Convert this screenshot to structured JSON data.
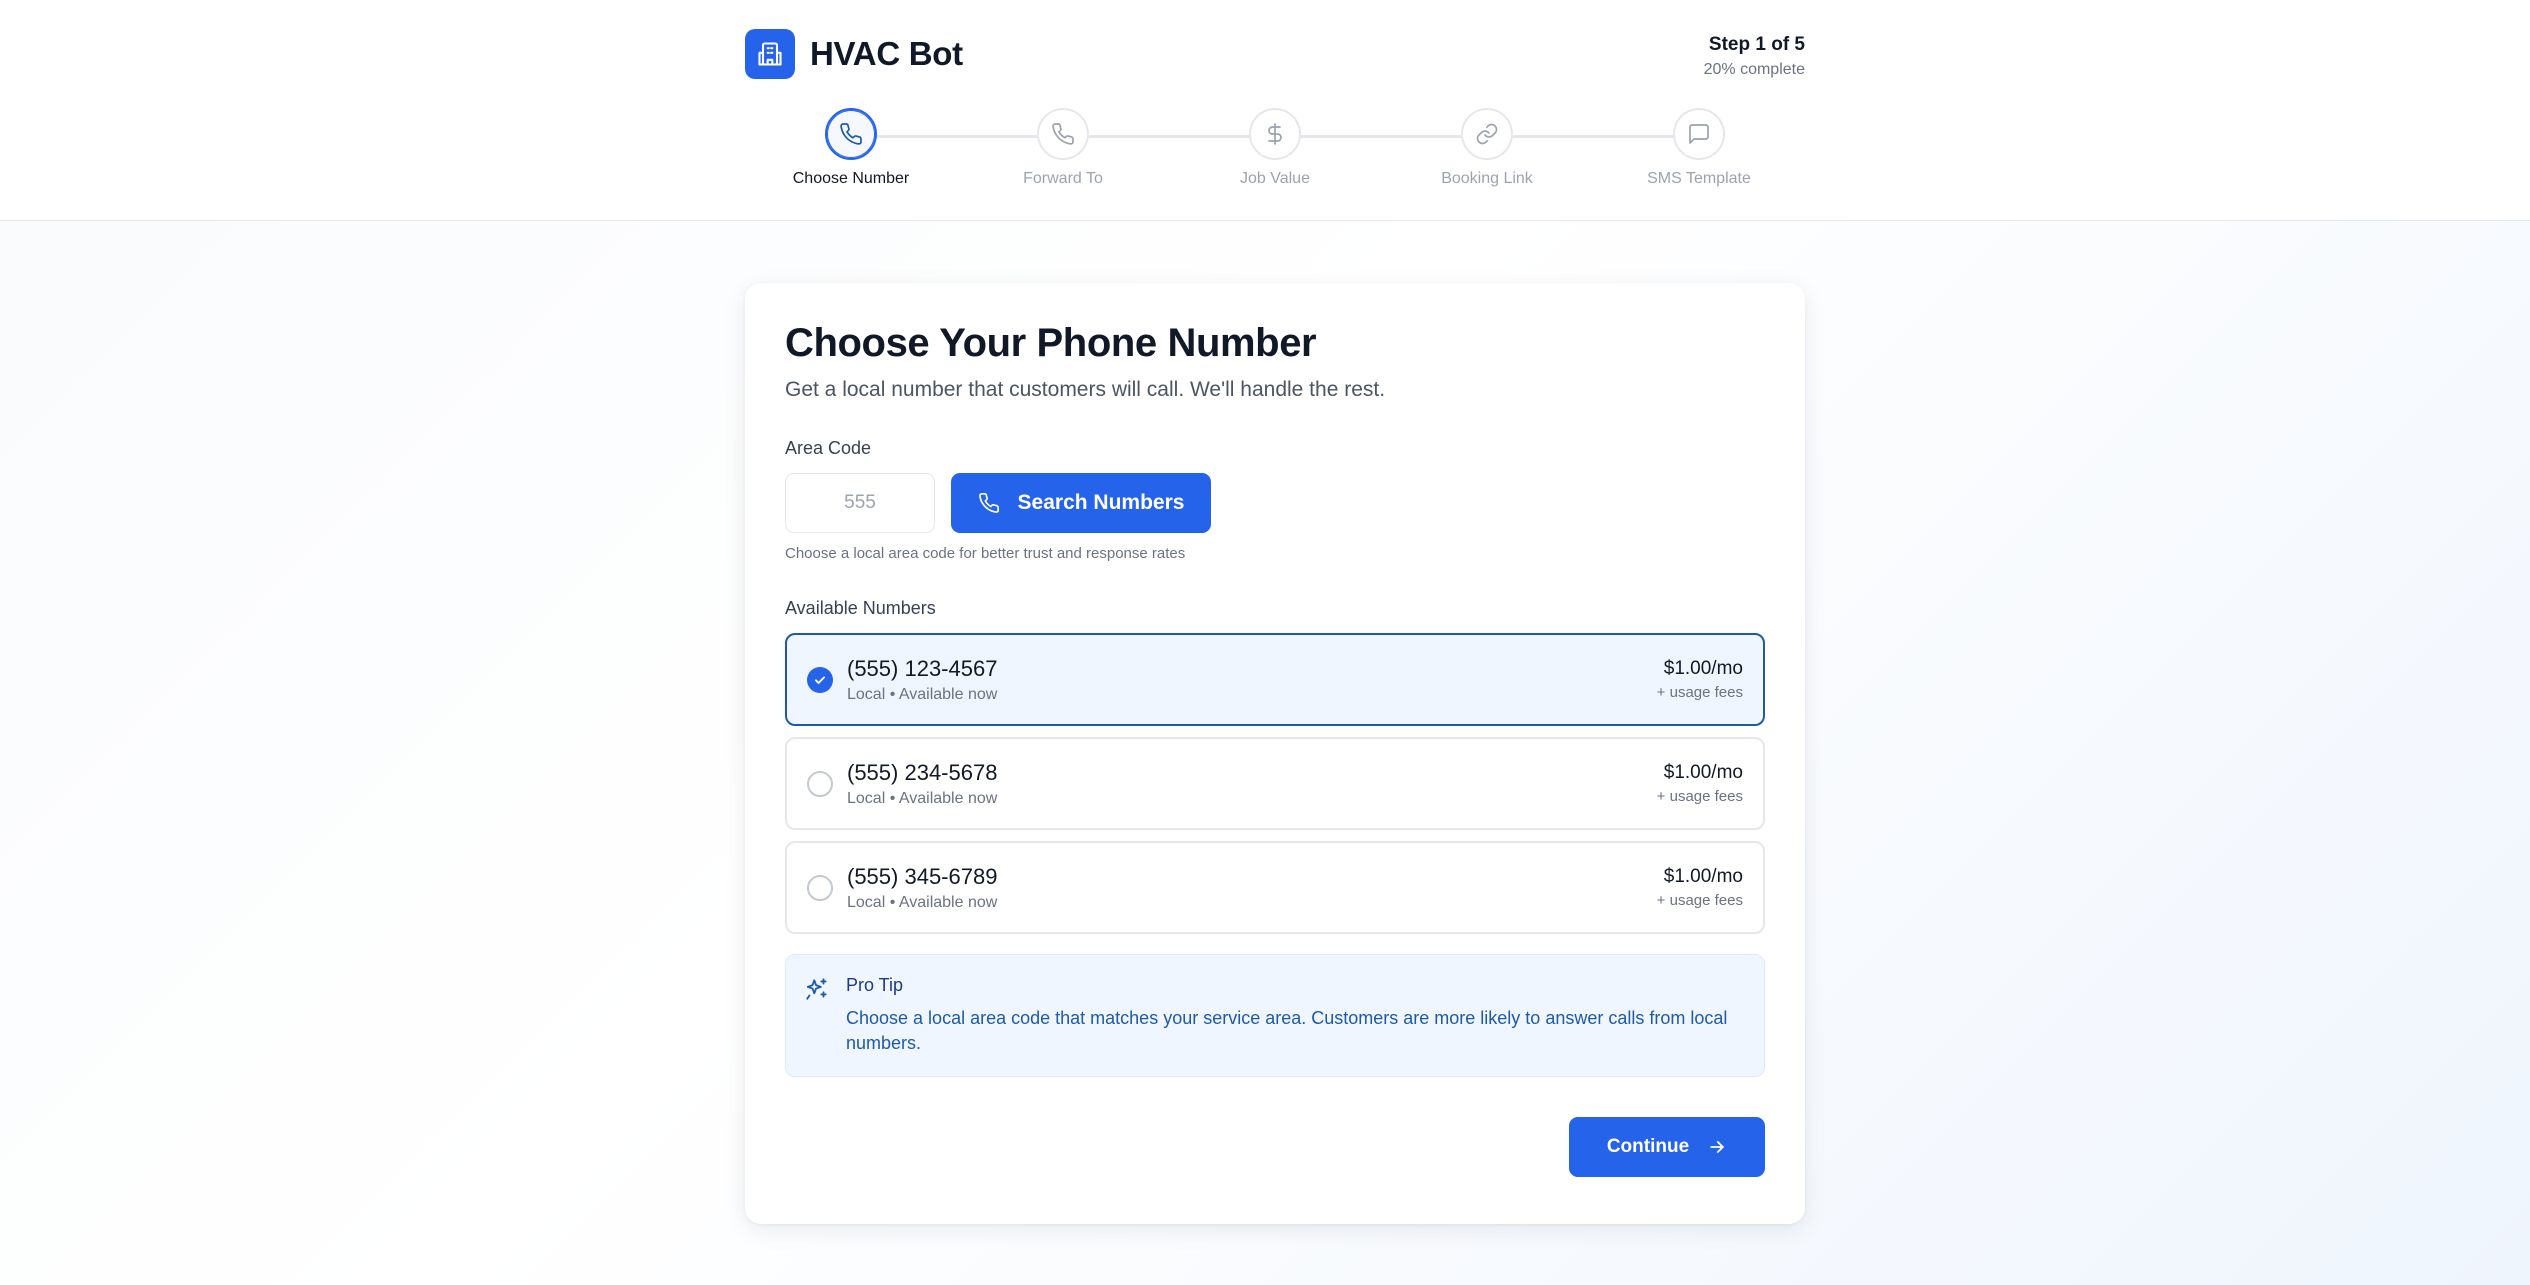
{
  "app": {
    "name": "HVAC Bot",
    "logo_icon": "building-icon"
  },
  "progress": {
    "step_label": "Step 1 of 5",
    "percent_label": "20% complete",
    "percent": 20
  },
  "steps": [
    {
      "label": "Choose Number",
      "icon": "phone-icon",
      "active": true
    },
    {
      "label": "Forward To",
      "icon": "phone-icon",
      "active": false
    },
    {
      "label": "Job Value",
      "icon": "dollar-icon",
      "active": false
    },
    {
      "label": "Booking Link",
      "icon": "link-icon",
      "active": false
    },
    {
      "label": "SMS Template",
      "icon": "message-icon",
      "active": false
    }
  ],
  "main": {
    "title": "Choose Your Phone Number",
    "subtitle": "Get a local number that customers will call. We'll handle the rest.",
    "area_code": {
      "label": "Area Code",
      "value": "",
      "placeholder": "555"
    },
    "search_button": "Search Numbers",
    "help_text": "Choose a local area code for better trust and response rates",
    "available_label": "Available Numbers",
    "numbers": [
      {
        "number": "(555) 123-4567",
        "meta": "Local • Available now",
        "price": "$1.00/mo",
        "fees": "+ usage fees",
        "selected": true
      },
      {
        "number": "(555) 234-5678",
        "meta": "Local • Available now",
        "price": "$1.00/mo",
        "fees": "+ usage fees",
        "selected": false
      },
      {
        "number": "(555) 345-6789",
        "meta": "Local • Available now",
        "price": "$1.00/mo",
        "fees": "+ usage fees",
        "selected": false
      }
    ],
    "tip": {
      "title": "Pro Tip",
      "text": "Choose a local area code that matches your service area. Customers are more likely to answer calls from local numbers.",
      "icon": "sparkles-icon"
    },
    "continue_button": "Continue"
  },
  "colors": {
    "primary": "#2563eb",
    "selected_border": "#1e5aa8",
    "selected_bg": "#eff6ff"
  }
}
